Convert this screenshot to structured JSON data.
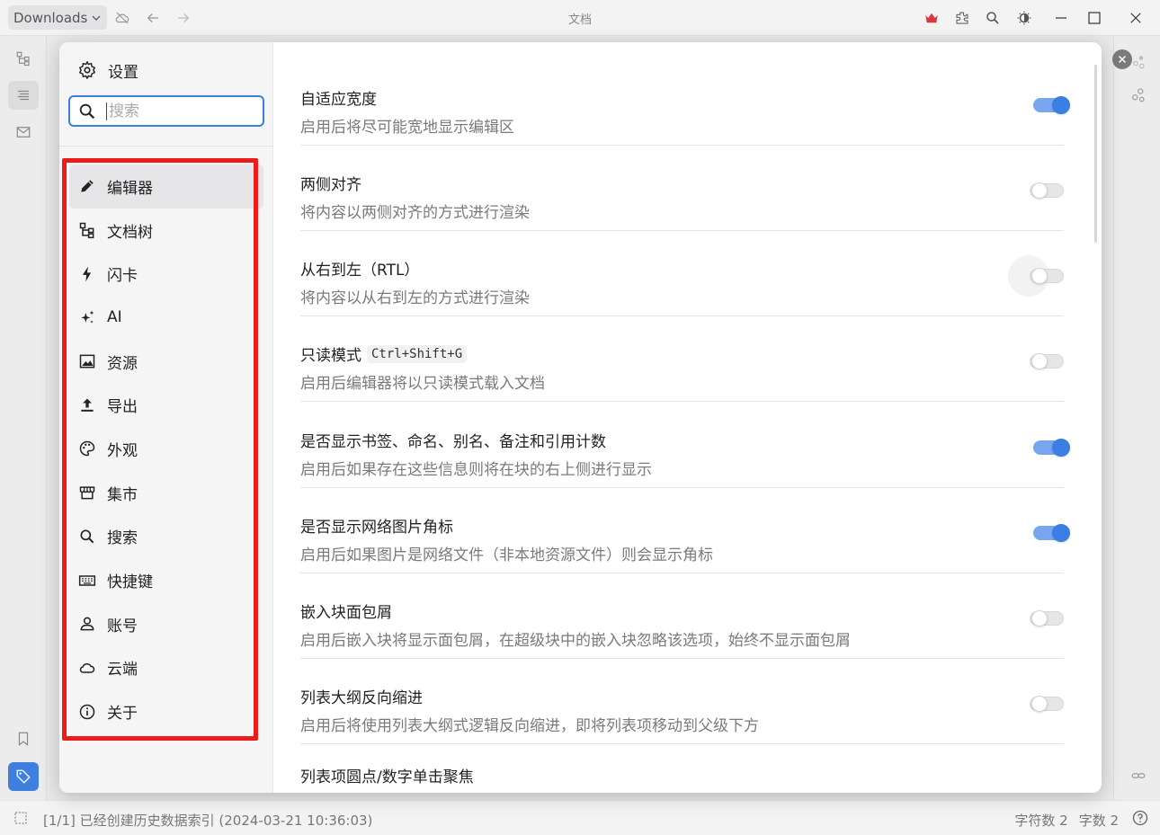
{
  "topbar": {
    "workspace_label": "Downloads",
    "doc_title": "文档"
  },
  "statusbar": {
    "message": "[1/1] 已经创建历史数据索引 (2024-03-21 10:36:03)",
    "char_count": "字符数 2",
    "word_count": "字数 2"
  },
  "settings": {
    "title": "设置",
    "search_placeholder": "搜索",
    "nav": [
      {
        "label": "编辑器",
        "icon": "pencil-icon"
      },
      {
        "label": "文档树",
        "icon": "tree-icon"
      },
      {
        "label": "闪卡",
        "icon": "lightning-icon"
      },
      {
        "label": "AI",
        "icon": "sparkle-icon"
      },
      {
        "label": "资源",
        "icon": "image-icon"
      },
      {
        "label": "导出",
        "icon": "upload-icon"
      },
      {
        "label": "外观",
        "icon": "palette-icon"
      },
      {
        "label": "集市",
        "icon": "store-icon"
      },
      {
        "label": "搜索",
        "icon": "search-icon"
      },
      {
        "label": "快捷键",
        "icon": "keyboard-icon"
      },
      {
        "label": "账号",
        "icon": "user-icon"
      },
      {
        "label": "云端",
        "icon": "cloud-icon"
      },
      {
        "label": "关于",
        "icon": "info-icon"
      }
    ],
    "items": [
      {
        "title": "自适应宽度",
        "desc": "启用后将尽可能宽地显示编辑区",
        "on": true
      },
      {
        "title": "两侧对齐",
        "desc": "将内容以两侧对齐的方式进行渲染",
        "on": false
      },
      {
        "title": "从右到左（RTL）",
        "desc": "将内容以从右到左的方式进行渲染",
        "on": false
      },
      {
        "title": "只读模式",
        "shortcut": "Ctrl+Shift+G",
        "desc": "启用后编辑器将以只读模式载入文档",
        "on": false
      },
      {
        "title": "是否显示书签、命名、别名、备注和引用计数",
        "desc": "启用后如果存在这些信息则将在块的右上侧进行显示",
        "on": true
      },
      {
        "title": "是否显示网络图片角标",
        "desc": "启用后如果图片是网络文件（非本地资源文件）则会显示角标",
        "on": true
      },
      {
        "title": "嵌入块面包屑",
        "desc": "启用后嵌入块将显示面包屑，在超级块中的嵌入块忽略该选项，始终不显示面包屑",
        "on": false
      },
      {
        "title": "列表大纲反向缩进",
        "desc": "启用后将使用列表大纲式逻辑反向缩进，即将列表项移动到父级下方",
        "on": false
      }
    ],
    "cut_item": "列表项圆点/数字单击聚焦"
  },
  "colors": {
    "accent": "#3b7ee4",
    "highlight_border": "#ee1b1b",
    "crown": "#d9363e"
  }
}
